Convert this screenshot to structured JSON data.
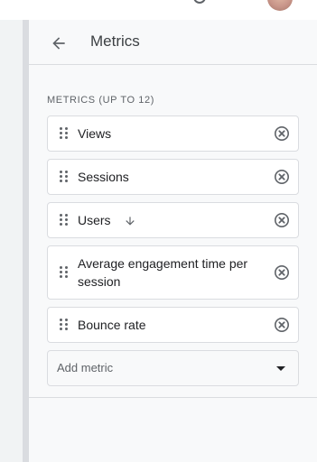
{
  "header": {
    "title": "Metrics",
    "back_icon": "arrow-back-icon"
  },
  "section": {
    "label": "METRICS (UP TO 12)"
  },
  "metrics": [
    {
      "label": "Views",
      "sorted": false
    },
    {
      "label": "Sessions",
      "sorted": false
    },
    {
      "label": "Users",
      "sorted": true,
      "sort_direction": "descending"
    },
    {
      "label": "Average engagement time per session",
      "sorted": false
    },
    {
      "label": "Bounce rate",
      "sorted": false
    }
  ],
  "add_metric": {
    "placeholder": "Add metric"
  },
  "colors": {
    "icon": "#5f6368",
    "border": "#dadce0",
    "panel_bg": "#f8f9fa",
    "text": "#202124"
  }
}
